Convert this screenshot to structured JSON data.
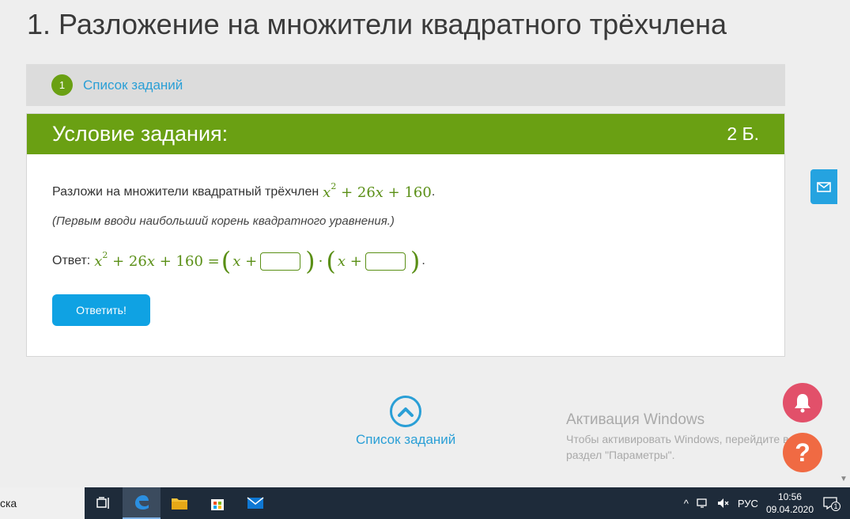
{
  "page": {
    "title": "1. Разложение на множители квадратного трёхчлена"
  },
  "breadcrumb": {
    "step": "1",
    "link": "Список заданий"
  },
  "task": {
    "header_title": "Условие задания:",
    "points": "2 Б.",
    "statement_text": "Разложи на множители квадратный трёхчлен",
    "polynomial": {
      "x": "x",
      "exp": "2",
      "rest": "+ 26",
      "rest_x": "x",
      "const": "+ 160"
    },
    "statement_end": ".",
    "hint": "(Первым вводи наибольший корень квадратного уравнения.)",
    "answer_label": "Ответ:",
    "answer_lhs": {
      "x": "x",
      "exp": "2",
      "rest": "+ 26",
      "rest_x": "x",
      "const": "+ 160 ="
    },
    "factor1": {
      "x": "x",
      "plus": "+",
      "value": ""
    },
    "factor2": {
      "x": "x",
      "plus": "+",
      "value": ""
    },
    "dot": "·",
    "answer_end": ".",
    "submit_label": "Ответить!"
  },
  "bottom_nav": {
    "link": "Список заданий"
  },
  "activation": {
    "title": "Активация Windows",
    "line1": "Чтобы активировать Windows, перейдите в",
    "line2": "раздел \"Параметры\"."
  },
  "help": {
    "symbol": "?"
  },
  "taskbar": {
    "search_text": "ска",
    "lang": "РУС",
    "time": "10:56",
    "date": "09.04.2020",
    "notifications": "1"
  },
  "colors": {
    "accent_green": "#6aa013",
    "link_blue": "#2a9fd6",
    "button_blue": "#0fa2e3",
    "bell": "#e2506a",
    "help": "#f06a43"
  }
}
